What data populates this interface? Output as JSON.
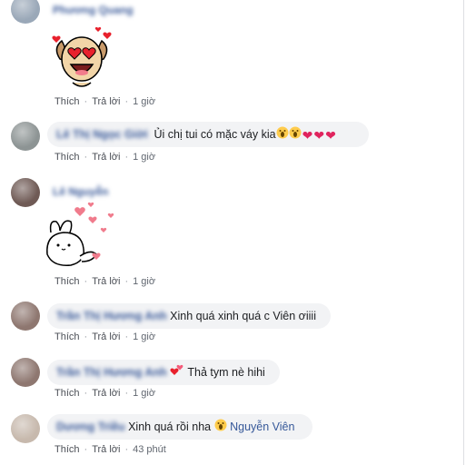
{
  "actions": {
    "like": "Thích",
    "reply": "Trả lời"
  },
  "comments": [
    {
      "name": "Phương Quang",
      "time": "1 giờ",
      "sticker": "sticker-dog-heart-eyes"
    },
    {
      "name": "Lê Thị Ngọc Giời",
      "text": "Ủi chị tui có mặc váy kia",
      "time": "1 giờ",
      "emojis": [
        "screaming-face",
        "screaming-face",
        "red-heart",
        "red-heart",
        "red-heart"
      ]
    },
    {
      "name": "Lê Nguyễn",
      "time": "1 giờ",
      "sticker": "sticker-bunny-hearts"
    },
    {
      "name": "Trần Thị Hương Anh",
      "text": "Xinh quá xinh quá c Viên ơiiii",
      "time": "1 giờ"
    },
    {
      "name": "Trần Thị Hương Anh",
      "text": "Thả tym nè hihi",
      "time": "1 giờ",
      "emojis": [
        "two-hearts"
      ]
    },
    {
      "name": "Dương Triều",
      "text": "Xinh quá rồi nha",
      "tag": "Nguyễn Viên",
      "time": "43 phút",
      "emojis": [
        "screaming-face"
      ]
    }
  ],
  "colors": {
    "link": "#385898",
    "bubble": "#f2f3f5",
    "meta": "#616770"
  }
}
